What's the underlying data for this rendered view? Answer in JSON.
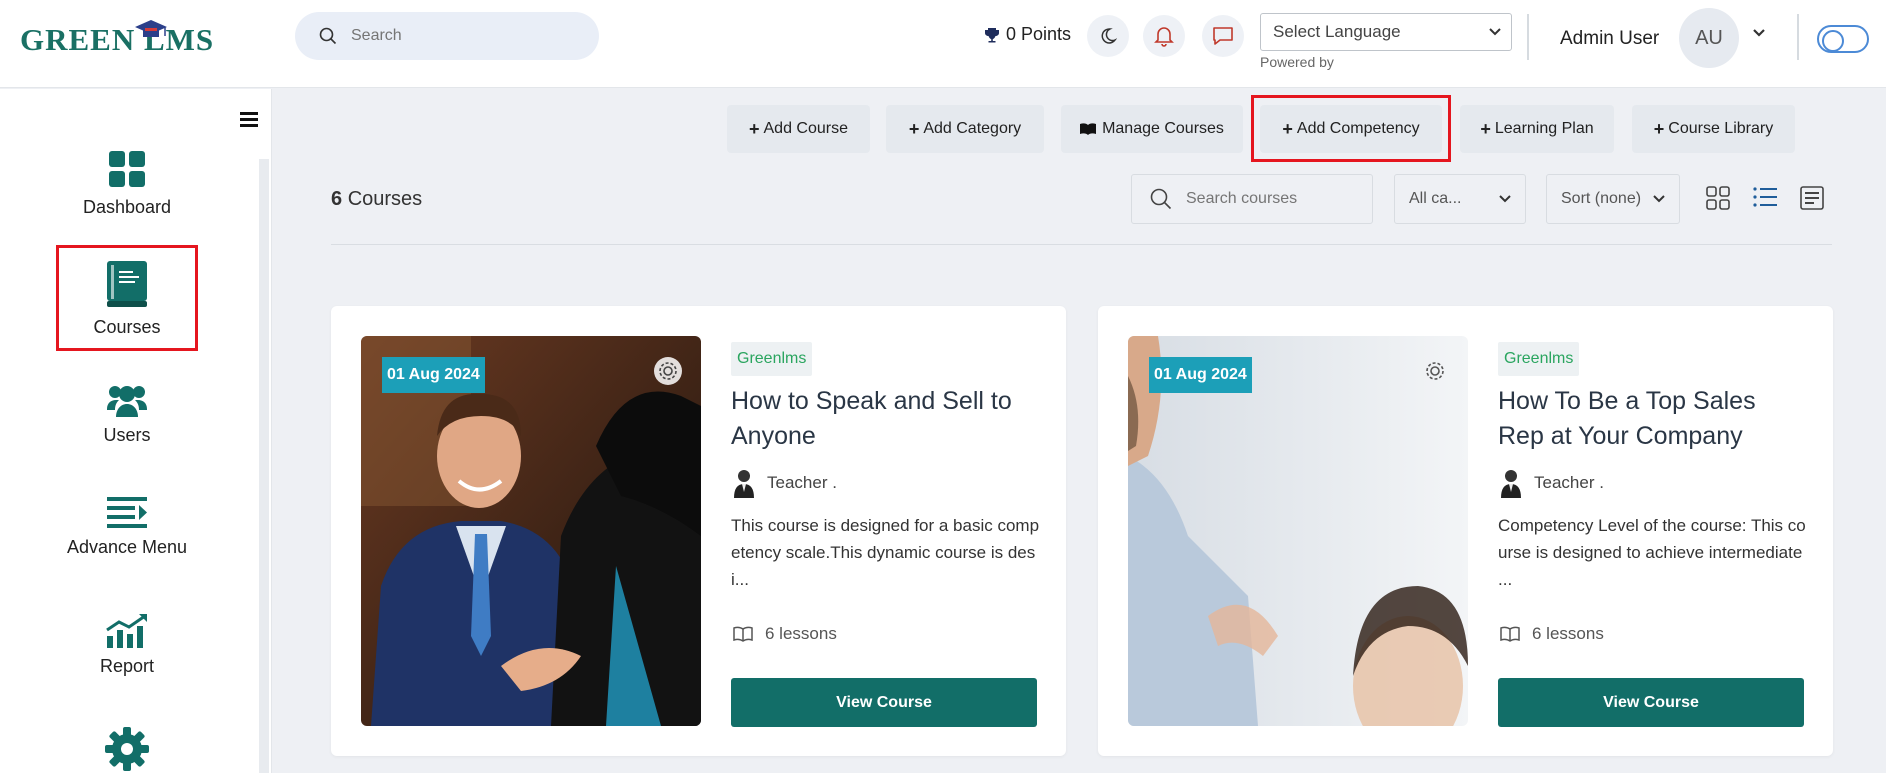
{
  "header": {
    "logo_text": "GREEN LMS",
    "search_placeholder": "Search",
    "points_label": "0 Points",
    "language_select": "Select Language",
    "powered_by": "Powered by",
    "user_name": "Admin User",
    "avatar_initials": "AU"
  },
  "sidebar": {
    "items": [
      {
        "label": "Dashboard",
        "icon": "dashboard-icon"
      },
      {
        "label": "Courses",
        "icon": "book-icon"
      },
      {
        "label": "Users",
        "icon": "users-icon"
      },
      {
        "label": "Advance Menu",
        "icon": "menu-arrow-icon"
      },
      {
        "label": "Report",
        "icon": "chart-icon"
      },
      {
        "label": "",
        "icon": "gear-icon"
      }
    ],
    "active": "Courses"
  },
  "toolbar": {
    "add_course": "Add Course",
    "add_category": "Add Category",
    "manage_courses": "Manage Courses",
    "add_competency": "Add Competency",
    "learning_plan": "Learning Plan",
    "course_library": "Course Library"
  },
  "filters": {
    "count_number": "6",
    "count_label": "Courses",
    "search_placeholder": "Search courses",
    "category": "All ca...",
    "sort": "Sort (none)"
  },
  "courses": [
    {
      "date": "01 Aug 2024",
      "tag": "Greenlms",
      "title": "How to Speak and Sell to Anyone",
      "teacher": "Teacher .",
      "description": "This course is designed for a basic competency scale.This dynamic course is desi...",
      "lessons": "6 lessons",
      "button": "View Course"
    },
    {
      "date": "01 Aug 2024",
      "tag": "Greenlms",
      "title": "How To Be a Top Sales Rep at Your Company",
      "teacher": "Teacher .",
      "description": "Competency Level of the course: This course is designed to achieve intermediate ...",
      "lessons": "6 lessons",
      "button": "View Course"
    }
  ],
  "colors": {
    "brand": "#126e68",
    "date_badge": "#1c9fb8",
    "tag_text": "#2aa55f",
    "highlight": "#e5161f"
  }
}
